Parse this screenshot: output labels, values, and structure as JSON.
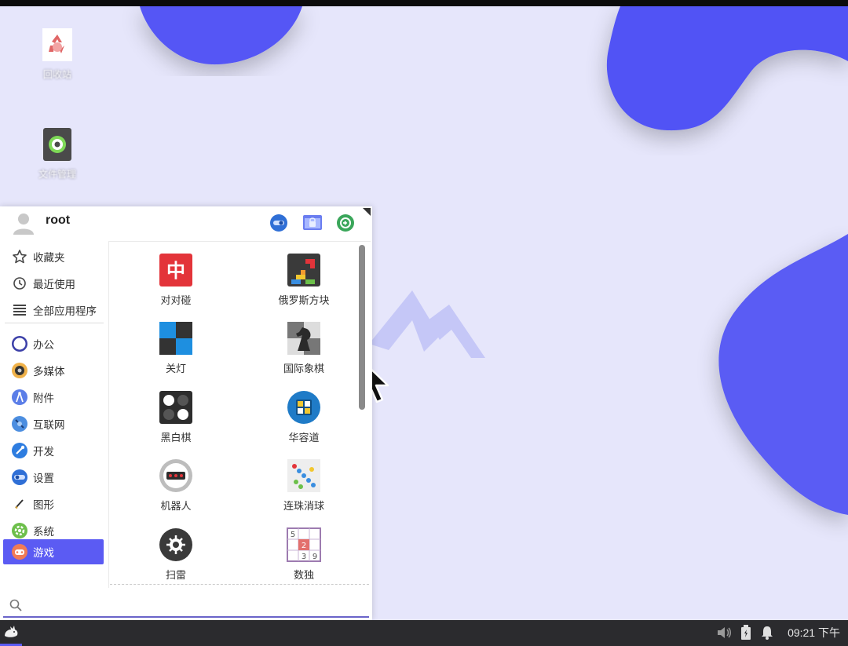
{
  "desktop": {
    "icons": [
      {
        "label": "回收站",
        "icon": "recycle-bin-icon"
      },
      {
        "label": "文件管理",
        "icon": "file-manager-icon"
      }
    ]
  },
  "menu": {
    "username": "root",
    "header_buttons": [
      "settings-toggle-icon",
      "lock-screen-icon",
      "power-icon"
    ],
    "sidebar": {
      "top_items": [
        {
          "label": "收藏夹",
          "icon": "star-icon"
        },
        {
          "label": "最近使用",
          "icon": "clock-icon"
        },
        {
          "label": "全部应用程序",
          "icon": "list-icon"
        }
      ],
      "categories": [
        {
          "label": "办公",
          "icon": "office-icon"
        },
        {
          "label": "多媒体",
          "icon": "multimedia-icon"
        },
        {
          "label": "附件",
          "icon": "accessories-icon"
        },
        {
          "label": "互联网",
          "icon": "internet-icon"
        },
        {
          "label": "开发",
          "icon": "development-icon"
        },
        {
          "label": "设置",
          "icon": "settings-icon"
        },
        {
          "label": "图形",
          "icon": "graphics-icon"
        },
        {
          "label": "系统",
          "icon": "system-icon"
        },
        {
          "label": "游戏",
          "icon": "games-icon",
          "active": true
        }
      ]
    },
    "apps": [
      {
        "name": "对对碰",
        "icon": "mahjong-icon"
      },
      {
        "name": "俄罗斯方块",
        "icon": "tetris-icon"
      },
      {
        "name": "关灯",
        "icon": "lights-off-icon"
      },
      {
        "name": "国际象棋",
        "icon": "chess-icon"
      },
      {
        "name": "黑白棋",
        "icon": "reversi-icon"
      },
      {
        "name": "华容道",
        "icon": "klotski-icon"
      },
      {
        "name": "机器人",
        "icon": "robots-icon"
      },
      {
        "name": "连珠消球",
        "icon": "five-or-more-icon"
      },
      {
        "name": "扫雷",
        "icon": "mines-icon"
      },
      {
        "name": "数独",
        "icon": "sudoku-icon"
      }
    ],
    "sudoku_digits": {
      "a": "5",
      "b": "2",
      "c": "3",
      "d": "9"
    },
    "mahjong_char": "中",
    "search": {
      "value": "",
      "placeholder": ""
    }
  },
  "taskbar": {
    "clock": "09:21 下午",
    "tray": [
      "volume-icon",
      "battery-icon",
      "notification-bell-icon"
    ]
  },
  "colors": {
    "accent": "#5b5bf3",
    "wallpaper": "#e6e6fb",
    "blob": "#5556f5",
    "taskbar": "#2b2b2e"
  }
}
